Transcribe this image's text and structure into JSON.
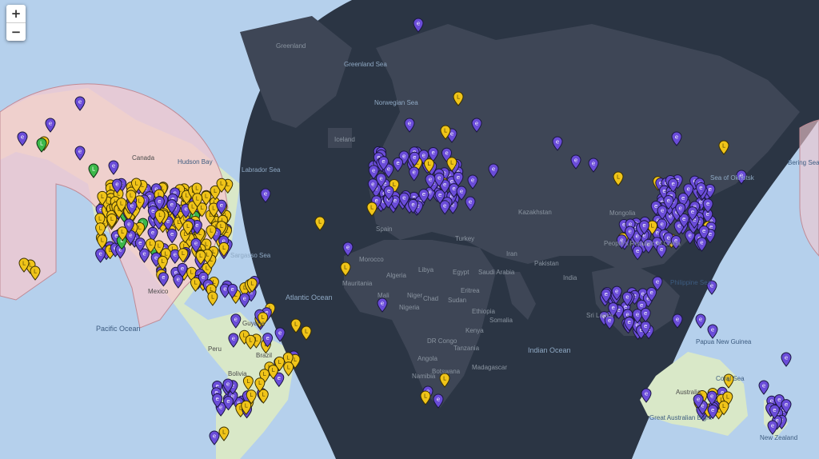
{
  "controls": {
    "zoom_in": "+",
    "zoom_out": "−"
  },
  "labels": {
    "greenland": "Greenland",
    "greenland_sea": "Greenland Sea",
    "norwegian_sea": "Norwegian Sea",
    "iceland": "Iceland",
    "canada": "Canada",
    "hudson_bay": "Hudson Bay",
    "labrador_sea": "Labrador Sea",
    "sargasso_sea": "Sargasso Sea",
    "atlantic_ocean": "Atlantic Ocean",
    "pacific_ocean": "Pacific Ocean",
    "indian_ocean": "Indian Ocean",
    "coral_sea": "Coral Sea",
    "great_australian_bight": "Great Australian Bight",
    "sea_of_okhotsk": "Sea of Okhotsk",
    "bering_sea": "Bering Sea",
    "philippine_sea": "Philippine Sea",
    "kazakhstan": "Kazakhstan",
    "mongolia": "Mongolia",
    "china": "People's Republic of China",
    "spain": "Spain",
    "turkey": "Turkey",
    "morocco": "Morocco",
    "algeria": "Algeria",
    "libya": "Libya",
    "egypt": "Egypt",
    "mali": "Mali",
    "niger": "Niger",
    "chad": "Chad",
    "sudan": "Sudan",
    "saudi_arabia": "Saudi Arabia",
    "iran": "Iran",
    "pakistan": "Pakistan",
    "india": "India",
    "sri_lanka": "Sri Lanka",
    "ethiopia": "Ethiopia",
    "kenya": "Kenya",
    "tanzania": "Tanzania",
    "dr_congo": "DR Congo",
    "angola": "Angola",
    "namibia": "Namibia",
    "botswana": "Botswana",
    "madagascar": "Madagascar",
    "mauritania": "Mauritania",
    "nigeria": "Nigeria",
    "brazil": "Brazil",
    "peru": "Peru",
    "bolivia": "Bolivia",
    "guyana": "Guyana",
    "australia": "Australia",
    "papua_new_guinea": "Papua New Guinea",
    "new_zealand": "New Zealand",
    "mexico": "Mexico",
    "eritrea": "Eritrea",
    "somalia": "Somalia"
  },
  "colors": {
    "night": "#2b3544",
    "day_water": "#b5d0ec",
    "night_land": "#3e4656",
    "day_land": "#d4e6c4",
    "range_fill": "#f5c8cf",
    "marker_purple": "#6a4cd8",
    "marker_yellow": "#f0c419",
    "marker_green": "#3cb84a"
  },
  "icons": {
    "zoom_in": "plus-icon",
    "zoom_out": "minus-icon",
    "marker": "map-pin-icon"
  }
}
